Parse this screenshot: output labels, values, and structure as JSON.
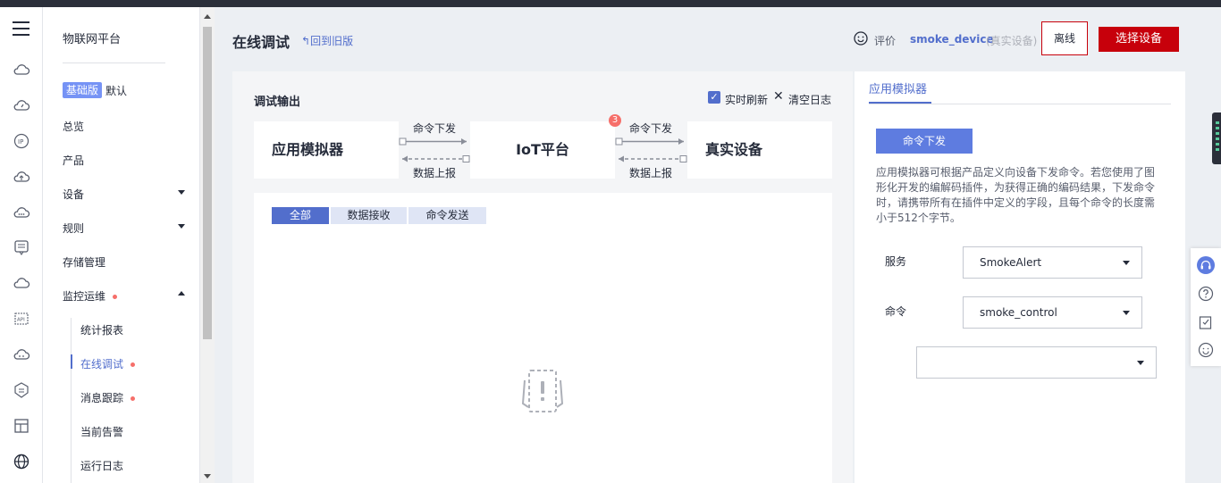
{
  "nav": {
    "platform_title": "物联网平台",
    "edition_badge": "基础版",
    "edition_text": "默认",
    "items": {
      "overview": "总览",
      "product": "产品",
      "device": "设备",
      "rules": "规则",
      "storage": "存储管理",
      "monitoring": "监控运维"
    },
    "sub_items": {
      "stats": "统计报表",
      "online_debug": "在线调试",
      "msg_trace": "消息跟踪",
      "alarm": "当前告警",
      "run_log": "运行日志"
    }
  },
  "header": {
    "title": "在线调试",
    "back_link": "回到旧版",
    "rate_label": "评价",
    "device_name": "smoke_device",
    "device_type": "(真实设备)",
    "offline_button": "离线",
    "select_device_button": "选择设备"
  },
  "debug": {
    "title": "调试输出",
    "realtime_label": "实时刷新",
    "clear_label": "清空日志",
    "flow": {
      "simulator": "应用模拟器",
      "platform": "IoT平台",
      "device": "真实设备",
      "cmd_down": "命令下发",
      "data_up": "数据上报",
      "badge_count": "3"
    },
    "tabs": [
      "全部",
      "数据接收",
      "命令发送"
    ]
  },
  "simulator": {
    "tab": "应用模拟器",
    "cmd_button": "命令下发",
    "description": "应用模拟器可根据产品定义向设备下发命令。若您使用了图形化开发的编解码插件，为获得正确的编码结果，下发命令时，请携带所有在插件中定义的字段，且每个命令的长度需小于512个字节。",
    "service_label": "服务",
    "service_value": "SmokeAlert",
    "command_label": "命令",
    "command_value": "smoke_control",
    "param_value": ""
  },
  "colors": {
    "accent": "#526ecc",
    "danger": "#c7000b",
    "tab_active": "#526ecc"
  }
}
